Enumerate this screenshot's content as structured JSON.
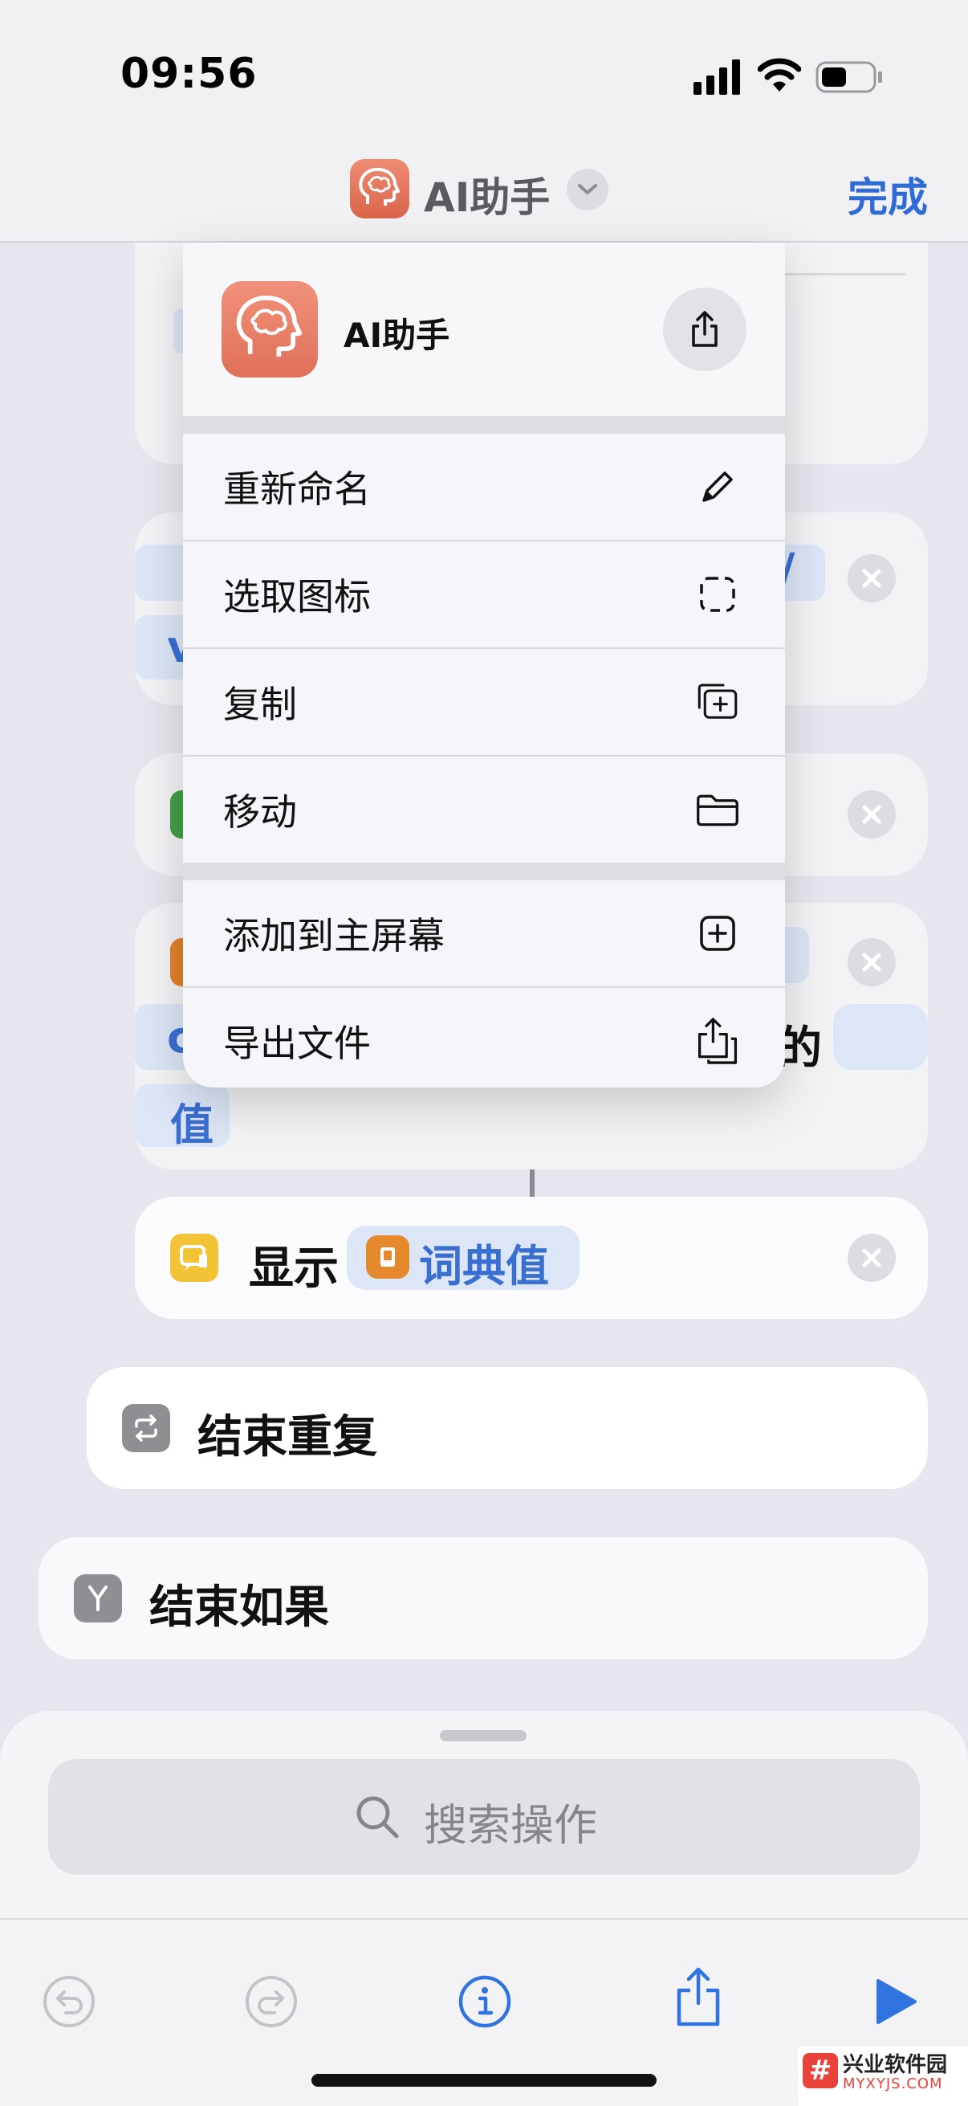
{
  "status_bar": {
    "time": "09:56"
  },
  "nav": {
    "title": "AI助手",
    "done_label": "完成"
  },
  "menu": {
    "app_name": "AI助手",
    "items": [
      {
        "label": "重新命名",
        "icon": "pencil-icon"
      },
      {
        "label": "选取图标",
        "icon": "dashed-square-icon"
      },
      {
        "label": "复制",
        "icon": "duplicate-icon"
      },
      {
        "label": "移动",
        "icon": "folder-icon"
      },
      {
        "label": "添加到主屏幕",
        "icon": "plus-square-icon"
      },
      {
        "label": "导出文件",
        "icon": "export-icon"
      }
    ]
  },
  "script": {
    "partial_texts": {
      "slash": "/",
      "v": "v",
      "c": "c",
      "de": "的",
      "value": "值"
    },
    "show_action": {
      "label": "显示",
      "token": "词典值"
    },
    "end_repeat": {
      "label": "结束重复"
    },
    "end_if": {
      "label": "结束如果"
    }
  },
  "search": {
    "placeholder": "搜索操作"
  },
  "watermark": {
    "name": "兴业软件园",
    "domain": "MYXYJS.COM",
    "badge": "#"
  }
}
